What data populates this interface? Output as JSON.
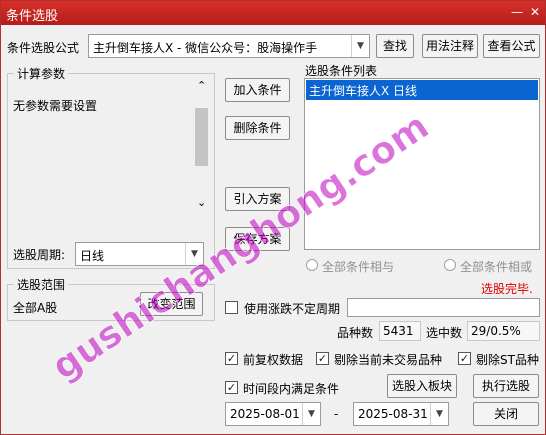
{
  "window": {
    "title": "条件选股",
    "minimize_glyph": "—",
    "close_glyph": "✕"
  },
  "formula": {
    "label": "条件选股公式",
    "value": "主升倒车接人X  -  微信公众号：股海操作手",
    "find_btn": "查找",
    "usage_btn": "用法注释",
    "view_btn": "查看公式"
  },
  "params": {
    "group_title": "计算参数",
    "text": "无参数需要设置",
    "scroll_up": "⌃",
    "scroll_down": "⌄"
  },
  "period": {
    "label": "选股周期:",
    "value": "日线"
  },
  "actions": {
    "add": "加入条件",
    "remove": "删除条件",
    "import": "引入方案",
    "save": "保存方案"
  },
  "condition_list": {
    "title": "选股条件列表",
    "items": [
      "主升倒车接人X  日线"
    ]
  },
  "logic": {
    "and": "全部条件相与",
    "or": "全部条件相或"
  },
  "status": {
    "text": "选股完毕.",
    "color": "#e00000"
  },
  "scope": {
    "group_title": "选股范围",
    "value": "全部A股",
    "change_btn": "改变范围"
  },
  "volatile_period": {
    "label": "使用涨跌不定周期",
    "checked": false
  },
  "stats": {
    "count_label": "品种数",
    "count_value": "5431",
    "selected_label": "选中数",
    "selected_value": "29/0.5%"
  },
  "options": {
    "adjusted": {
      "label": "前复权数据",
      "checked": true
    },
    "exclude_untraded": {
      "label": "剔除当前未交易品种",
      "checked": true
    },
    "exclude_st": {
      "label": "剔除ST品种",
      "checked": true
    },
    "time_range": {
      "label": "时间段内满足条件",
      "checked": true
    }
  },
  "bottom": {
    "to_block_btn": "选股入板块",
    "run_btn": "执行选股",
    "close_btn": "关闭",
    "date_from": "2025-08-01",
    "date_sep": "-",
    "date_to": "2025-08-31"
  },
  "watermark": {
    "text": "gushichanghong.com",
    "color": "#c000c0"
  }
}
